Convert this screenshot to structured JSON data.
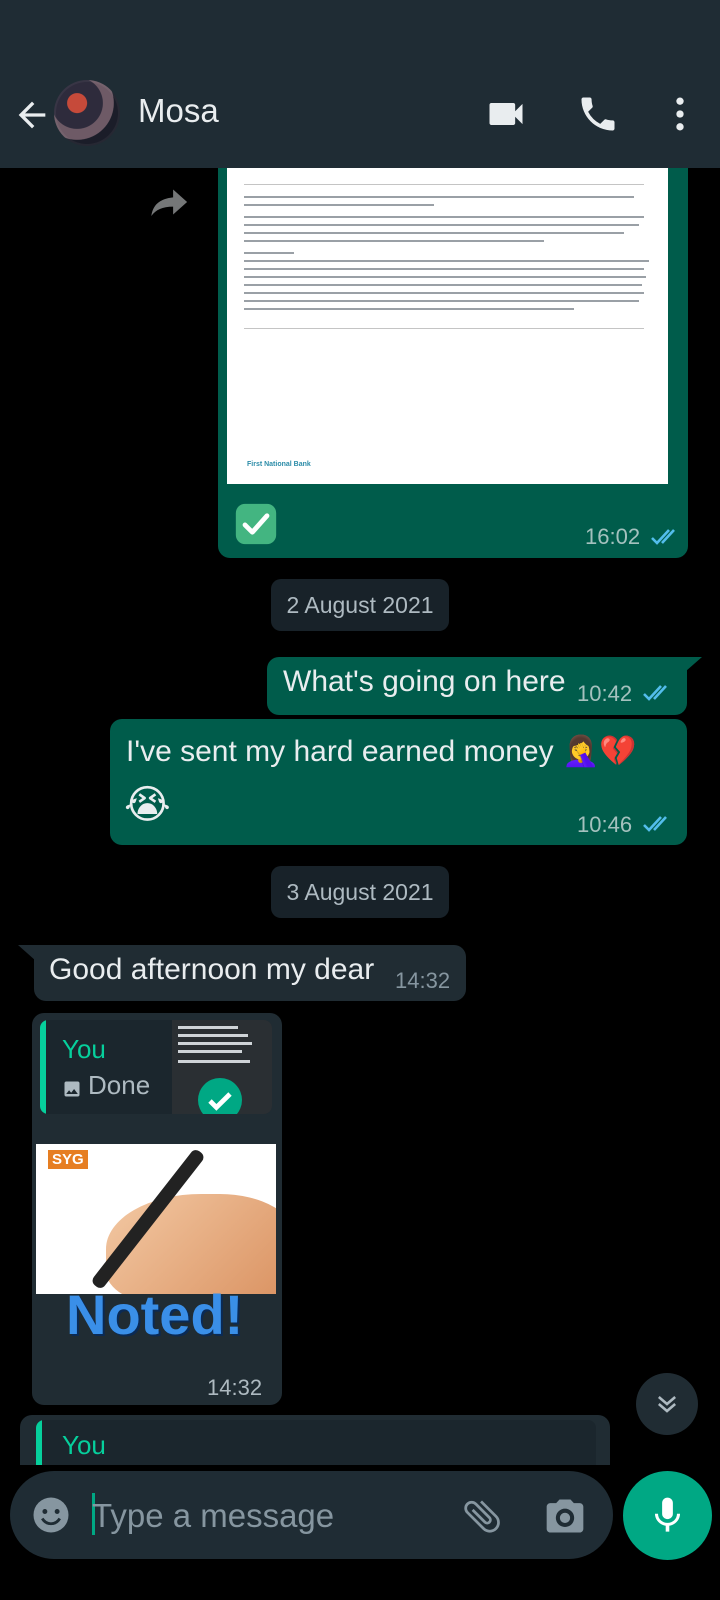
{
  "header": {
    "contact_name": "Mosa",
    "icons": [
      "back-arrow-icon",
      "video-call-icon",
      "voice-call-icon",
      "more-vert-icon"
    ]
  },
  "messages": {
    "doc_time": "16:02",
    "doc_footer": "First National Bank",
    "date_1": "2 August 2021",
    "out_1_text": "What's going on here",
    "out_1_time": "10:42",
    "out_2_text": "I've sent my hard earned money 🤦‍♀️💔",
    "out_2_emoji": "😭",
    "out_2_time": "10:46",
    "date_2": "3 August 2021",
    "in_1_text": "Good afternoon my dear",
    "in_1_time": "14:32",
    "in_2_reply_author": "You",
    "in_2_reply_text": "Done",
    "in_2_sticker_brand": "SYG",
    "in_2_sticker_text": "Noted!",
    "in_2_time": "14:32",
    "in_3_reply_author": "You"
  },
  "composer": {
    "placeholder": "Type a message"
  },
  "colors": {
    "accent": "#00a884",
    "outgoing_bubble": "#005c4b",
    "incoming_bubble": "#202c33",
    "read_ticks": "#53bdeb"
  }
}
